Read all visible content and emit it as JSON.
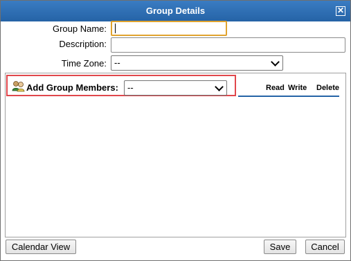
{
  "dialog": {
    "title": "Group Details",
    "close_glyph": "✕"
  },
  "form": {
    "group_name_label": "Group Name:",
    "group_name_value": "",
    "description_label": "Description:",
    "description_value": "",
    "timezone_label": "Time Zone:",
    "timezone_value": "--"
  },
  "members": {
    "add_label": "Add Group Members:",
    "add_select_value": "--",
    "columns": [
      "Read",
      "Write",
      "Delete"
    ],
    "icon": "group-users-icon",
    "highlight_color": "#e0474c"
  },
  "footer": {
    "calendar_view_label": "Calendar View",
    "save_label": "Save",
    "cancel_label": "Cancel"
  },
  "colors": {
    "titlebar": "#2563a6",
    "focus_border": "#e0a32e"
  }
}
